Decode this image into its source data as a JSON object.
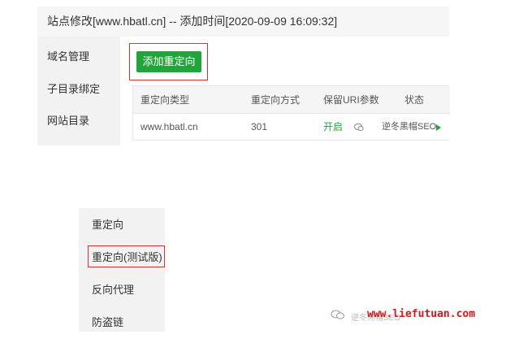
{
  "titlebar": {
    "text": "站点修改[www.hbatl.cn] -- 添加时间[2020-09-09 16:09:32]"
  },
  "sidebar": {
    "items": [
      {
        "label": "域名管理"
      },
      {
        "label": "子目录绑定"
      },
      {
        "label": "网站目录"
      }
    ]
  },
  "toolbar": {
    "add_redirect_label": "添加重定向"
  },
  "table": {
    "headers": [
      "重定向类型",
      "重定向方式",
      "保留URI参数",
      "状态"
    ],
    "rows": [
      {
        "type": "www.hbatl.cn",
        "method": "301",
        "keep_uri": "开启",
        "status": "逆冬黑帽SEO"
      }
    ]
  },
  "menu": {
    "items": [
      {
        "label": "重定向"
      },
      {
        "label": "重定向(测试版)"
      },
      {
        "label": "反向代理"
      },
      {
        "label": "防盗链"
      }
    ]
  },
  "watermark": {
    "site": "www.liefutuan.com",
    "faint": "逆冬黑帽SEO",
    "icon": "wechat-icon"
  },
  "colors": {
    "accent_green": "#20a53a",
    "highlight_red": "#d9342b",
    "watermark_red": "#e0161b"
  }
}
